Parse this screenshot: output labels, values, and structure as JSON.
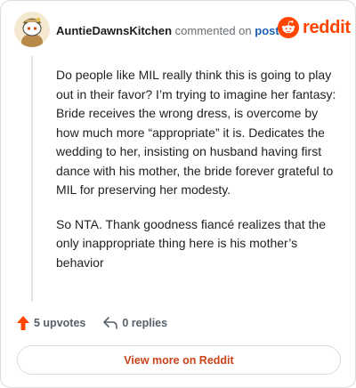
{
  "comment": {
    "username": "AuntieDawnsKitchen",
    "action_text": "commented on",
    "post_link": "post",
    "paragraphs": [
      "Do people like MIL really think this is going to play out in their favor? I’m trying to imagine her fantasy: Bride receives the wrong dress, is overcome by how much more “appropriate” it is. Dedicates the wedding to her, insisting on husband having first dance with his mother, the bride forever grateful to MIL for preserving her modesty.",
      "So NTA. Thank goodness fiancé realizes that the only inappropriate thing here is his mother’s behavior"
    ]
  },
  "brand": {
    "wordmark": "reddit",
    "color": "#ff4500"
  },
  "footer": {
    "upvotes": "5 upvotes",
    "replies": "0 replies",
    "view_more": "View more on Reddit"
  },
  "icons": {
    "avatar": "snoo-avatar-icon",
    "logo": "reddit-snoo-icon",
    "upvote": "upvote-arrow-icon",
    "reply": "reply-arrow-icon"
  }
}
